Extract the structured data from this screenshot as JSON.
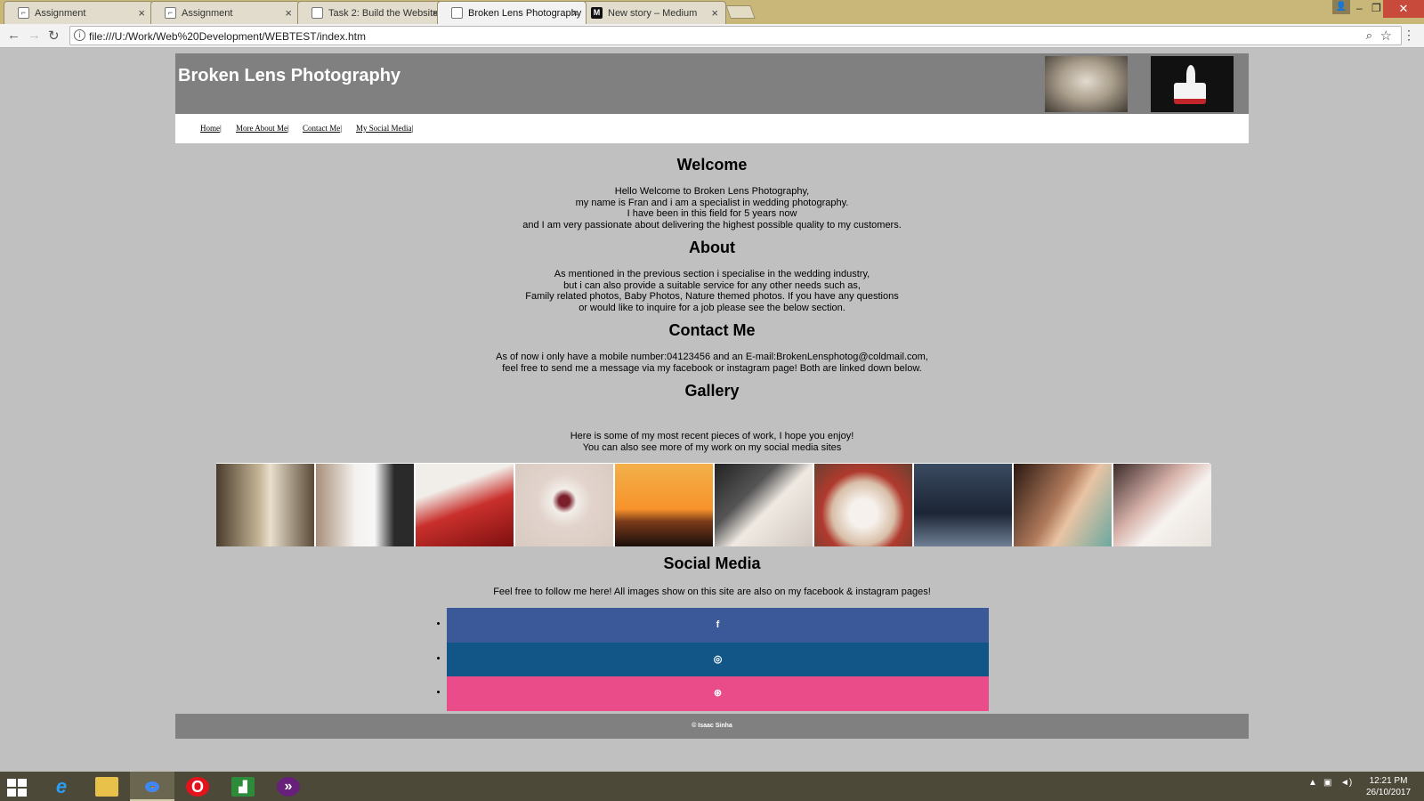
{
  "browser": {
    "tabs": [
      {
        "title": "Assignment",
        "icon": "doc-icon",
        "active": false
      },
      {
        "title": "Assignment",
        "icon": "doc-icon",
        "active": false
      },
      {
        "title": "Task 2: Build the Website",
        "icon": "page-icon",
        "active": false
      },
      {
        "title": "Broken Lens Photography",
        "icon": "page-icon",
        "active": true
      },
      {
        "title": "New story – Medium",
        "icon": "medium-icon",
        "active": false
      }
    ],
    "url": "file:///U:/Work/Web%20Development/WEBTEST/index.htm"
  },
  "site": {
    "title": "Broken Lens Photography",
    "nav": [
      "Home",
      "More About Me",
      "Contact Me",
      "My Social Media"
    ],
    "nav_separator": "|",
    "sections": {
      "welcome": {
        "title": "Welcome",
        "lines": [
          "Hello Welcome to Broken Lens Photography,",
          "my name is Fran and i am a specialist in wedding photography.",
          "I have been in this field for 5 years now",
          "and I am very passionate about delivering the highest possible quality to my customers."
        ]
      },
      "about": {
        "title": "About",
        "lines": [
          "As mentioned in the previous section i specialise in the wedding industry,",
          "but i can also provide a suitable service for any other needs such as,",
          "Family related photos, Baby Photos, Nature themed photos. If you have any questions",
          "or would like to inquire for a job please see the below section."
        ]
      },
      "contact": {
        "title": "Contact Me",
        "lines": [
          "As of now i only have a mobile number:04123456 and an E-mail:BrokenLensphotog@coldmail.com,",
          "feel free to send me a message via my facebook or instagram page! Both are linked down below."
        ]
      },
      "gallery": {
        "title": "Gallery",
        "lines": [
          "Here is some of my most recent pieces of work, I hope you enjoy!",
          "You can also see more of my work on my social media sites"
        ],
        "thumbnails": [
          "bride-sepia",
          "bride-bouquet",
          "hands-roses",
          "bouquet-brick",
          "sunset-kiss",
          "ring-hands",
          "cake-topper",
          "groomsmen-shoes",
          "family-kiss",
          "bouquet-dress"
        ]
      },
      "social": {
        "title": "Social Media",
        "lines": [
          "Feel free to follow me here! All images show on this site are also on my facebook & instagram pages!"
        ],
        "links": [
          {
            "name": "facebook",
            "glyph": "f",
            "color": "#3b5998"
          },
          {
            "name": "instagram",
            "glyph": "◎",
            "color": "#125688"
          },
          {
            "name": "dribbble",
            "glyph": "⊛",
            "color": "#ea4c89"
          }
        ]
      }
    },
    "footer": "© Isaac Sinha"
  },
  "taskbar": {
    "apps": [
      "start",
      "internet-explorer",
      "file-explorer",
      "chrome",
      "opera",
      "project",
      "visual-studio"
    ],
    "time": "12:21 PM",
    "date": "26/10/2017"
  }
}
